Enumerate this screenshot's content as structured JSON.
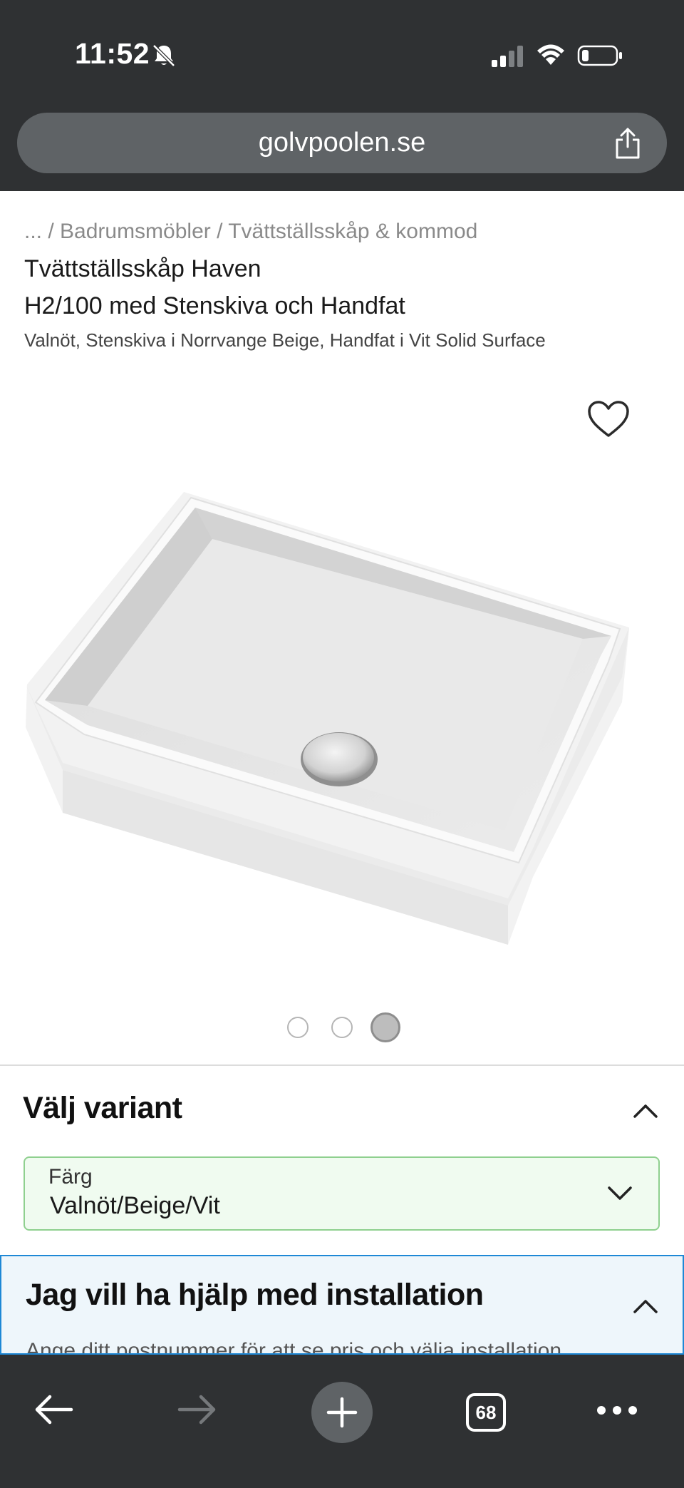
{
  "status_bar": {
    "time": "11:52",
    "icons": [
      "bell-slash-icon",
      "signal-icon",
      "wifi-icon",
      "battery-icon"
    ]
  },
  "browser": {
    "url": "golvpoolen.se",
    "tab_count": "68"
  },
  "product": {
    "breadcrumb": "... / Badrumsmöbler / Tvättställsskåp & kommod",
    "title_line1": "Tvättställsskåp Haven",
    "title_line2": "H2/100 med Stenskiva och Handfat",
    "subtitle": "Valnöt, Stenskiva i Norrvange Beige, Handfat i Vit Solid Surface",
    "image_count": 3,
    "active_image_index": 2
  },
  "variant": {
    "heading": "Välj variant",
    "color_label": "Färg",
    "color_value": "Valnöt/Beige/Vit"
  },
  "installation": {
    "heading": "Jag vill ha hjälp med installation",
    "hint": "Ange ditt postnummer för att se pris och välja installation"
  },
  "colors": {
    "chrome_bg": "#2f3133",
    "url_bar": "#5f6366",
    "select_border": "#8fd08f",
    "select_bg": "#f0fbf0",
    "install_border": "#1e88d6",
    "install_bg": "#eef6fb"
  }
}
